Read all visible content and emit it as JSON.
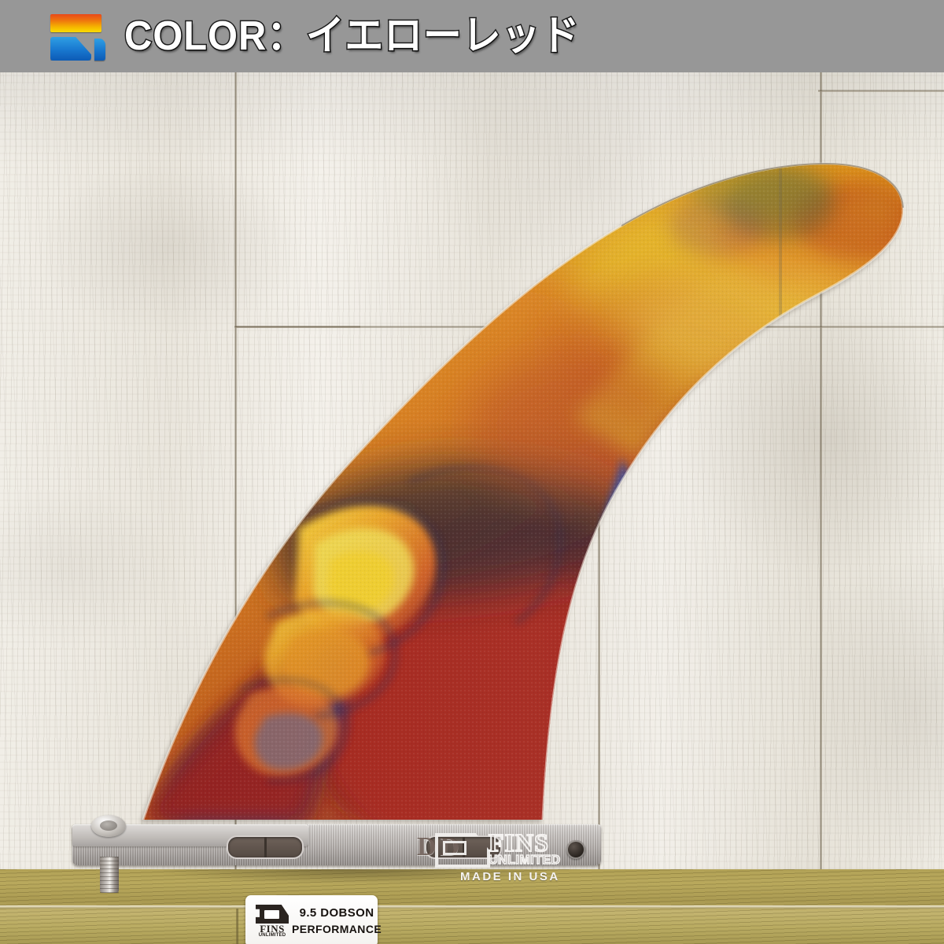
{
  "header": {
    "logo_icon": "fins-unlimited-logo-icon",
    "title": "COLOR：イエローレッド",
    "label_prefix": "COLOR",
    "color_value": "イエローレッド",
    "background_color": "#979797",
    "text_color": "#ffffff",
    "outline_color": "#1a1a1a"
  },
  "product_photo": {
    "alt": "surfboard-longboard-fin-yellow-red",
    "scene": {
      "wall_description": "whitewashed wood plank wall",
      "wall_color": "#f1eee7",
      "floor_description": "olive wood plank floor",
      "floor_color": "#b2a257"
    },
    "fin": {
      "colorway": "yellow-red resin tint",
      "accent_colors": {
        "yellow": "#e8b21a",
        "orange": "#d9641c",
        "red": "#a8241f",
        "blue": "#1c4fb0",
        "amber": "#c98b1c"
      },
      "printed_logo": {
        "mark_icon": "fins-unlimited-mark-icon",
        "brand_line1": "FINS",
        "brand_line2": "UNLIMITED",
        "origin": "MADE IN USA"
      },
      "base": {
        "engraving": "DD",
        "material": "aluminum",
        "screw_icon": "fin-screw-icon",
        "bolt_icon": "fin-bolt-icon",
        "slot_icon": "fin-base-slot-icon",
        "hole_icon": "fin-base-hole-icon"
      },
      "spec_sticker": {
        "logo_icon": "fins-unlimited-mark-icon",
        "logo_text": "FINS",
        "logo_subtext": "UNLIMITED",
        "line1": "9.5 DOBSON",
        "line2": "PERFORMANCE"
      }
    }
  }
}
